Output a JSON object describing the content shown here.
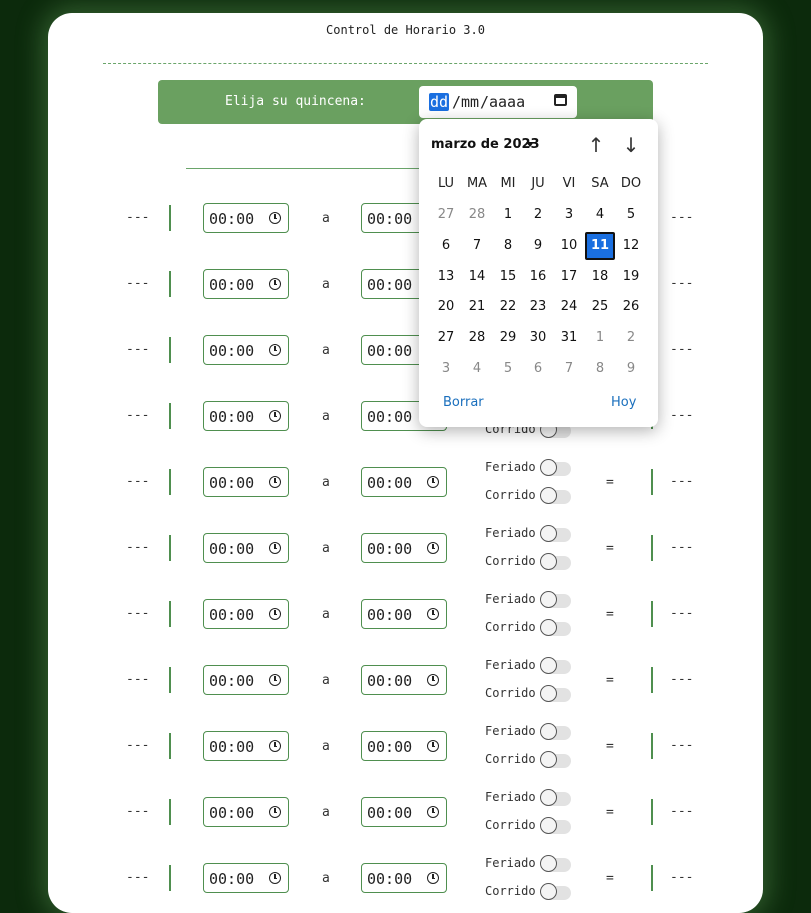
{
  "app": {
    "title": "Control de Horario 3.0"
  },
  "selector": {
    "label": "Elija su quincena:",
    "date_day": "dd",
    "date_sep": "/",
    "date_month": "mm",
    "date_year": "aaaa",
    "icon": "calendar-icon"
  },
  "row_template": {
    "dash": "---",
    "time_value": "00:00",
    "between": "a",
    "holiday_label": "Feriado",
    "continuous_label": "Corrido",
    "equals": "=",
    "result": "---",
    "clock_icon": "clock-icon"
  },
  "calendar": {
    "month_label": "marzo de 2023",
    "prev_icon": "arrow-up-icon",
    "next_icon": "arrow-down-icon",
    "prev_glyph": "↑",
    "next_glyph": "↓",
    "weekdays": [
      "LU",
      "MA",
      "MI",
      "JU",
      "VI",
      "SA",
      "DO"
    ],
    "weeks": [
      [
        "27",
        "28",
        "1",
        "2",
        "3",
        "4",
        "5"
      ],
      [
        "6",
        "7",
        "8",
        "9",
        "10",
        "11",
        "12"
      ],
      [
        "13",
        "14",
        "15",
        "16",
        "17",
        "18",
        "19"
      ],
      [
        "20",
        "21",
        "22",
        "23",
        "24",
        "25",
        "26"
      ],
      [
        "27",
        "28",
        "29",
        "30",
        "31",
        "1",
        "2"
      ],
      [
        "3",
        "4",
        "5",
        "6",
        "7",
        "8",
        "9"
      ]
    ],
    "selected_day": "11",
    "clear_label": "Borrar",
    "today_label": "Hoy"
  },
  "colors": {
    "background": "#0c2a0c",
    "accent": "#6aa060",
    "selection": "#1a6fe0"
  }
}
